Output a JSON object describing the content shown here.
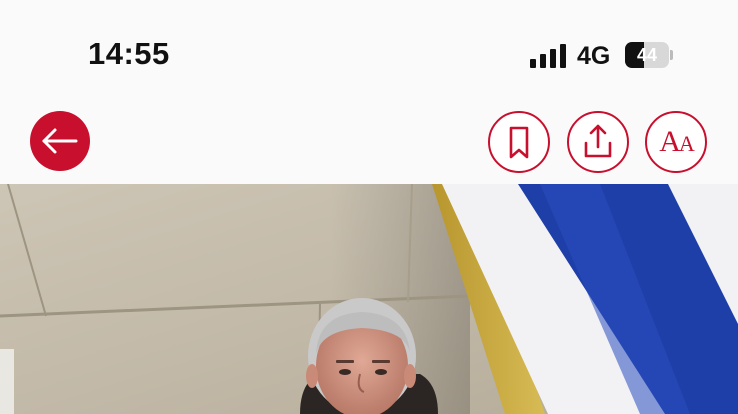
{
  "status_bar": {
    "time": "14:55",
    "network": "4G",
    "battery_level": "44",
    "battery_fraction": 0.44
  },
  "toolbar": {
    "back_icon": "arrow-left-icon",
    "bookmark_icon": "bookmark-icon",
    "share_icon": "share-icon",
    "font_size_icon": "font-size-icon",
    "accent_color": "#c8102e"
  },
  "article": {
    "hero_image_icon": "photo-of-man-before-stone-wall-and-flag"
  }
}
